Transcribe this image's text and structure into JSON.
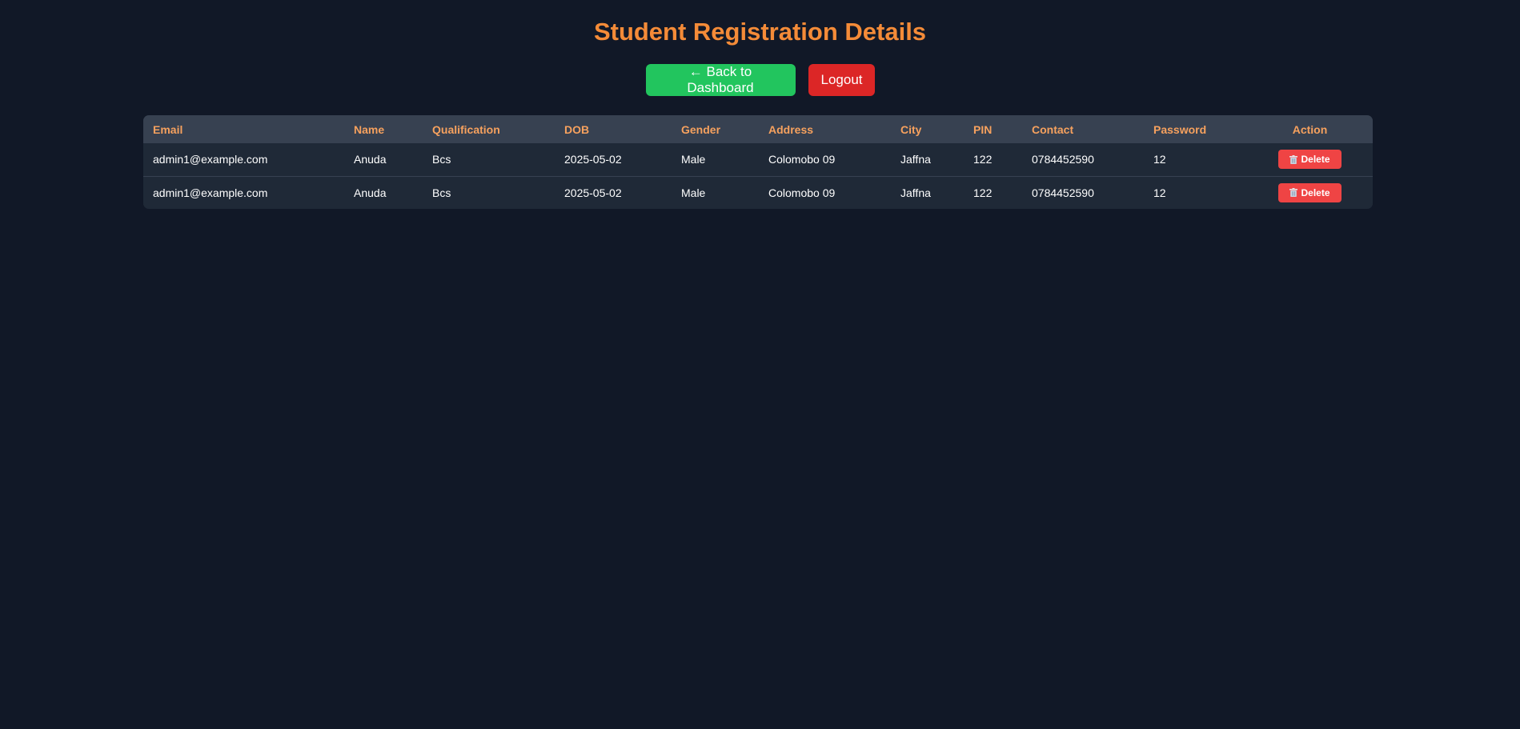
{
  "page": {
    "title": "Student Registration Details"
  },
  "actions": {
    "back_label": "← Back to Dashboard",
    "logout_label": "Logout"
  },
  "table": {
    "columns": [
      "Email",
      "Name",
      "Qualification",
      "DOB",
      "Gender",
      "Address",
      "City",
      "PIN",
      "Contact",
      "Password",
      "Action"
    ],
    "rows": [
      {
        "email": "admin1@example.com",
        "name": "Anuda",
        "qualification": "Bcs",
        "dob": "2025-05-02",
        "gender": "Male",
        "address": "Colomobo 09",
        "city": "Jaffna",
        "pin": "122",
        "contact": "0784452590",
        "password": "12",
        "delete_label": "Delete"
      },
      {
        "email": "admin1@example.com",
        "name": "Anuda",
        "qualification": "Bcs",
        "dob": "2025-05-02",
        "gender": "Male",
        "address": "Colomobo 09",
        "city": "Jaffna",
        "pin": "122",
        "contact": "0784452590",
        "password": "12",
        "delete_label": "Delete"
      }
    ]
  },
  "icons": {
    "delete": "trash-icon"
  },
  "colors": {
    "background": "#111827",
    "accent": "#f48b38",
    "header_text": "#f6a15e",
    "back_button": "#22c55e",
    "logout_button": "#dc2626",
    "delete_button": "#ef4444"
  }
}
